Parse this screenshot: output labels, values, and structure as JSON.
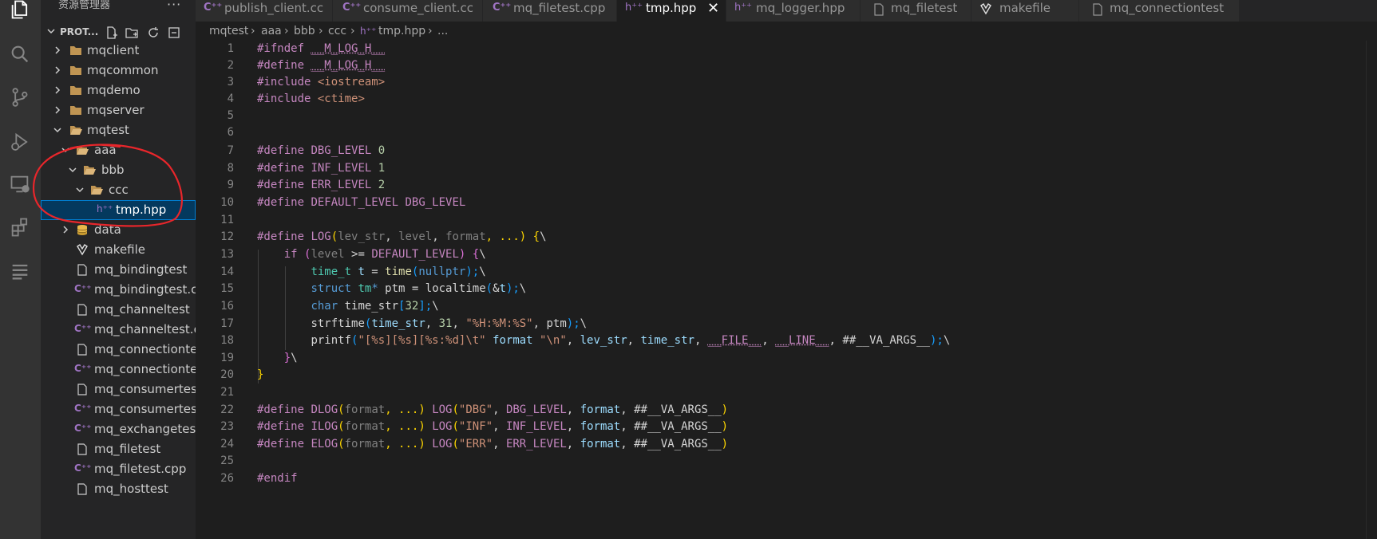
{
  "sidebar": {
    "title": "资源管理器",
    "more": "···",
    "section_label": "PROT...",
    "items": [
      {
        "label": "mqclient",
        "type": "folder",
        "indent": 0,
        "expanded": false
      },
      {
        "label": "mqcommon",
        "type": "folder",
        "indent": 0,
        "expanded": false
      },
      {
        "label": "mqdemo",
        "type": "folder",
        "indent": 0,
        "expanded": false
      },
      {
        "label": "mqserver",
        "type": "folder",
        "indent": 0,
        "expanded": false
      },
      {
        "label": "mqtest",
        "type": "folder-open",
        "indent": 0,
        "expanded": true
      },
      {
        "label": "aaa",
        "type": "folder-open",
        "indent": 1,
        "expanded": true
      },
      {
        "label": "bbb",
        "type": "folder-open",
        "indent": 2,
        "expanded": true
      },
      {
        "label": "ccc",
        "type": "folder-open",
        "indent": 3,
        "expanded": true
      },
      {
        "label": "tmp.hpp",
        "type": "hpp",
        "indent": 4,
        "selected": true
      },
      {
        "label": "data",
        "type": "db",
        "indent": 1,
        "expanded": false
      },
      {
        "label": "makefile",
        "type": "makefile",
        "indent": 1
      },
      {
        "label": "mq_bindingtest",
        "type": "file",
        "indent": 1
      },
      {
        "label": "mq_bindingtest.c...",
        "type": "cpp",
        "indent": 1
      },
      {
        "label": "mq_channeltest",
        "type": "file",
        "indent": 1
      },
      {
        "label": "mq_channeltest.c...",
        "type": "cpp",
        "indent": 1
      },
      {
        "label": "mq_connectiontest",
        "type": "file",
        "indent": 1
      },
      {
        "label": "mq_connectionte...",
        "type": "cpp",
        "indent": 1
      },
      {
        "label": "mq_consumertest",
        "type": "file",
        "indent": 1
      },
      {
        "label": "mq_consumertes...",
        "type": "cpp",
        "indent": 1
      },
      {
        "label": "mq_exchangetest...",
        "type": "cpp",
        "indent": 1
      },
      {
        "label": "mq_filetest",
        "type": "file",
        "indent": 1
      },
      {
        "label": "mq_filetest.cpp",
        "type": "cpp",
        "indent": 1
      },
      {
        "label": "mq_hosttest",
        "type": "file",
        "indent": 1
      }
    ]
  },
  "tabs": [
    {
      "label": "publish_client.cc",
      "icon": "C++",
      "active": false
    },
    {
      "label": "consume_client.cc",
      "icon": "C++",
      "active": false
    },
    {
      "label": "mq_filetest.cpp",
      "icon": "C++",
      "active": false
    },
    {
      "label": "tmp.hpp",
      "icon": "h++",
      "active": true
    },
    {
      "label": "mq_logger.hpp",
      "icon": "h++",
      "active": false
    },
    {
      "label": "mq_filetest",
      "icon": "file",
      "active": false
    },
    {
      "label": "makefile",
      "icon": "makefile",
      "active": false
    },
    {
      "label": "mq_connectiontest",
      "icon": "file",
      "active": false
    }
  ],
  "breadcrumb": [
    "mqtest",
    "aaa",
    "bbb",
    "ccc",
    "tmp.hpp",
    "..."
  ],
  "line_numbers": [
    "1",
    "2",
    "3",
    "4",
    "5",
    "6",
    "7",
    "8",
    "9",
    "10",
    "11",
    "12",
    "13",
    "14",
    "15",
    "16",
    "17",
    "18",
    "19",
    "20",
    "21",
    "22",
    "23",
    "24",
    "25",
    "26"
  ],
  "code": {
    "l1a": "#ifndef",
    "l1b": "__M_LOG_H__",
    "l2a": "#define",
    "l2b": "__M_LOG_H__",
    "l3a": "#include",
    "l3b": "<iostream>",
    "l4a": "#include",
    "l4b": "<ctime>",
    "l7a": "#define",
    "l7b": "DBG_LEVEL",
    "l7c": "0",
    "l8a": "#define",
    "l8b": "INF_LEVEL",
    "l8c": "1",
    "l9a": "#define",
    "l9b": "ERR_LEVEL",
    "l9c": "2",
    "l10a": "#define",
    "l10b": "DEFAULT_LEVEL",
    "l10c": "DBG_LEVEL",
    "l12a": "#define",
    "l12b": "LOG",
    "l12c": "(",
    "l12d": "lev_str",
    "l12e": ", ",
    "l12f": "level",
    "l12g": ", ",
    "l12h": "format",
    "l12i": ", ...)",
    "l12j": " {",
    "l12k": "\\",
    "l13a": "if",
    "l13b": " (",
    "l13c": "level",
    "l13d": " >= ",
    "l13e": "DEFAULT_LEVEL",
    "l13f": ")",
    "l13g": " {",
    "l13h": "\\",
    "l14a": "time_t",
    "l14b": " t",
    "l14c": " = ",
    "l14d": "time",
    "l14e": "(",
    "l14f": "nullptr",
    "l14g": ");",
    "l14h": "\\",
    "l15a": "struct",
    "l15b": " tm",
    "l15c": "*",
    "l15d": " ptm",
    "l15e": " = ",
    "l15f": "localtime",
    "l15g": "(",
    "l15h": "&",
    "l15i": "t",
    "l15j": ");",
    "l15k": "\\",
    "l16a": "char",
    "l16b": " time_str",
    "l16c": "[",
    "l16d": "32",
    "l16e": "];",
    "l16f": "\\",
    "l17a": "strftime",
    "l17b": "(",
    "l17c": "time_str",
    "l17d": ", ",
    "l17e": "31",
    "l17f": ", ",
    "l17g": "\"%H:%M:%S\"",
    "l17h": ", ",
    "l17i": "ptm",
    "l17j": ");",
    "l17k": "\\",
    "l18a": "printf",
    "l18b": "(",
    "l18c": "\"[%s][%s][%s:%d]\\t\"",
    "l18d": " format ",
    "l18e": "\"\\n\"",
    "l18f": ", ",
    "l18g": "lev_str",
    "l18h": ", ",
    "l18i": "time_str",
    "l18j": ", ",
    "l18k": "__FILE__",
    "l18l": ", ",
    "l18m": "__LINE__",
    "l18n": ", ",
    "l18o": "##__VA_ARGS__",
    "l18p": ");",
    "l18q": "\\",
    "l19a": "}",
    "l19b": "\\",
    "l20a": "}",
    "l22a": "#define",
    "l22b": "DLOG",
    "l22c": "(",
    "l22d": "format",
    "l22e": ", ...)",
    "l22f": " LOG",
    "l22g": "(",
    "l22h": "\"DBG\"",
    "l22i": ", ",
    "l22j": "DBG_LEVEL",
    "l22k": ", ",
    "l22l": "format",
    "l22m": ", ##__VA_ARGS__",
    "l22n": ")",
    "l23a": "#define",
    "l23b": "ILOG",
    "l23c": "(",
    "l23d": "format",
    "l23e": ", ...)",
    "l23f": " LOG",
    "l23g": "(",
    "l23h": "\"INF\"",
    "l23i": ", ",
    "l23j": "INF_LEVEL",
    "l23k": ", ",
    "l23l": "format",
    "l23m": ", ##__VA_ARGS__",
    "l23n": ")",
    "l24a": "#define",
    "l24b": "ELOG",
    "l24c": "(",
    "l24d": "format",
    "l24e": ", ...)",
    "l24f": " LOG",
    "l24g": "(",
    "l24h": "\"ERR\"",
    "l24i": ", ",
    "l24j": "ERR_LEVEL",
    "l24k": ", ",
    "l24l": "format",
    "l24m": ", ##__VA_ARGS__",
    "l24n": ")",
    "l26a": "#endif"
  },
  "colors": {
    "activity_bar": "#333333",
    "sidebar": "#252526",
    "editor": "#1e1e1e",
    "selection": "#04395e",
    "annotation": "#e8262b",
    "folder": "#c09553"
  }
}
